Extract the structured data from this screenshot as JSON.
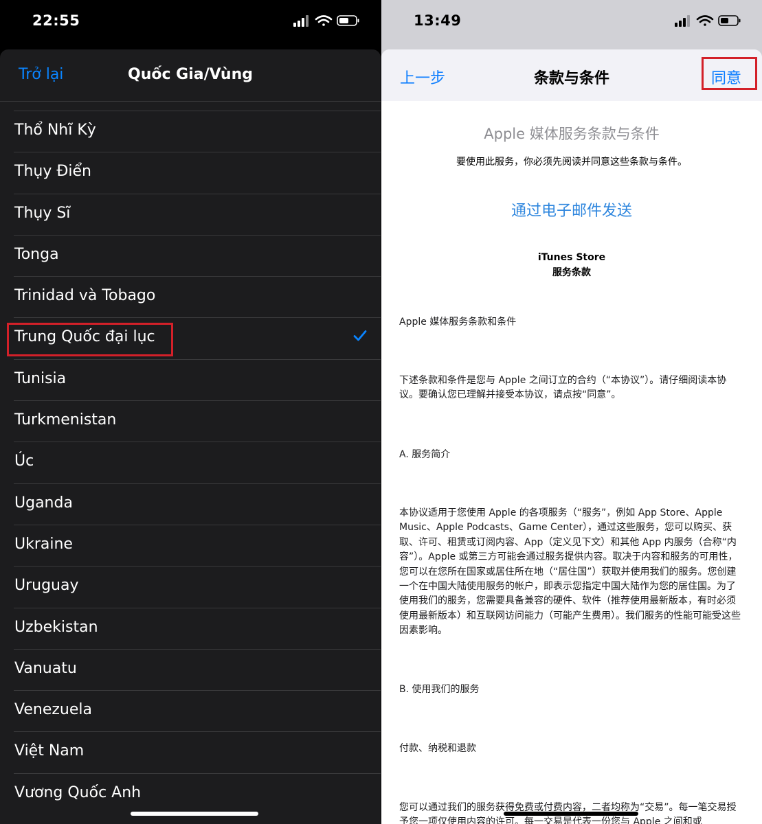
{
  "left": {
    "status_time": "22:55",
    "nav_back": "Trở lại",
    "nav_title": "Quốc Gia/Vùng",
    "countries": [
      "Thổ Nhĩ Kỳ",
      "Thụy Điển",
      "Thụy Sĩ",
      "Tonga",
      "Trinidad và Tobago",
      "Trung Quốc đại lục",
      "Tunisia",
      "Turkmenistan",
      "Úc",
      "Uganda",
      "Ukraine",
      "Uruguay",
      "Uzbekistan",
      "Vanuatu",
      "Venezuela",
      "Việt Nam",
      "Vương Quốc Anh"
    ],
    "selected_country": "Trung Quốc đại lục"
  },
  "right": {
    "status_time": "13:49",
    "nav_back": "上一步",
    "nav_title": "条款与条件",
    "nav_agree": "同意",
    "doc_heading": "Apple 媒体服务条款与条件",
    "doc_subtitle": "要使用此服务，你必须先阅读并同意这些条款与条件。",
    "email_link": "通过电子邮件发送",
    "store_title_1": "iTunes Store",
    "store_title_2": "服务条款",
    "para_1": "Apple 媒体服务条款和条件",
    "para_2": "下述条款和条件是您与 Apple 之间订立的合约（“本协议”）。请仔细阅读本协议。要确认您已理解并接受本协议，请点按“同意”。",
    "para_3": "A. 服务简介",
    "para_4": "本协议适用于您使用 Apple 的各项服务（“服务”，例如 App Store、Apple Music、Apple Podcasts、Game Center），通过这些服务，您可以购买、获取、许可、租赁或订阅内容、App（定义见下文）和其他 App 内服务（合称“内容”）。Apple 或第三方可能会通过服务提供内容。取决于内容和服务的可用性，您可以在您所在国家或居住所在地（“居住国”）获取并使用我们的服务。您创建一个在中国大陆使用服务的帐户，即表示您指定中国大陆作为您的居住国。为了使用我们的服务，您需要具备兼容的硬件、软件（推荐使用最新版本，有时必须使用最新版本）和互联网访问能力（可能产生费用）。我们服务的性能可能受这些因素影响。",
    "para_5": "B. 使用我们的服务",
    "para_6": "付款、纳税和退款",
    "para_7": "您可以通过我们的服务获得免费或付费内容，二者均称为“交易”。每一笔交易授予您一项仅使用内容的许可。每一交易是代表一份您与 Apple 之间和或"
  },
  "colors": {
    "ios_blue": "#0a84ff",
    "highlight_red": "#d32029",
    "dark_bg": "#1c1c1e"
  }
}
